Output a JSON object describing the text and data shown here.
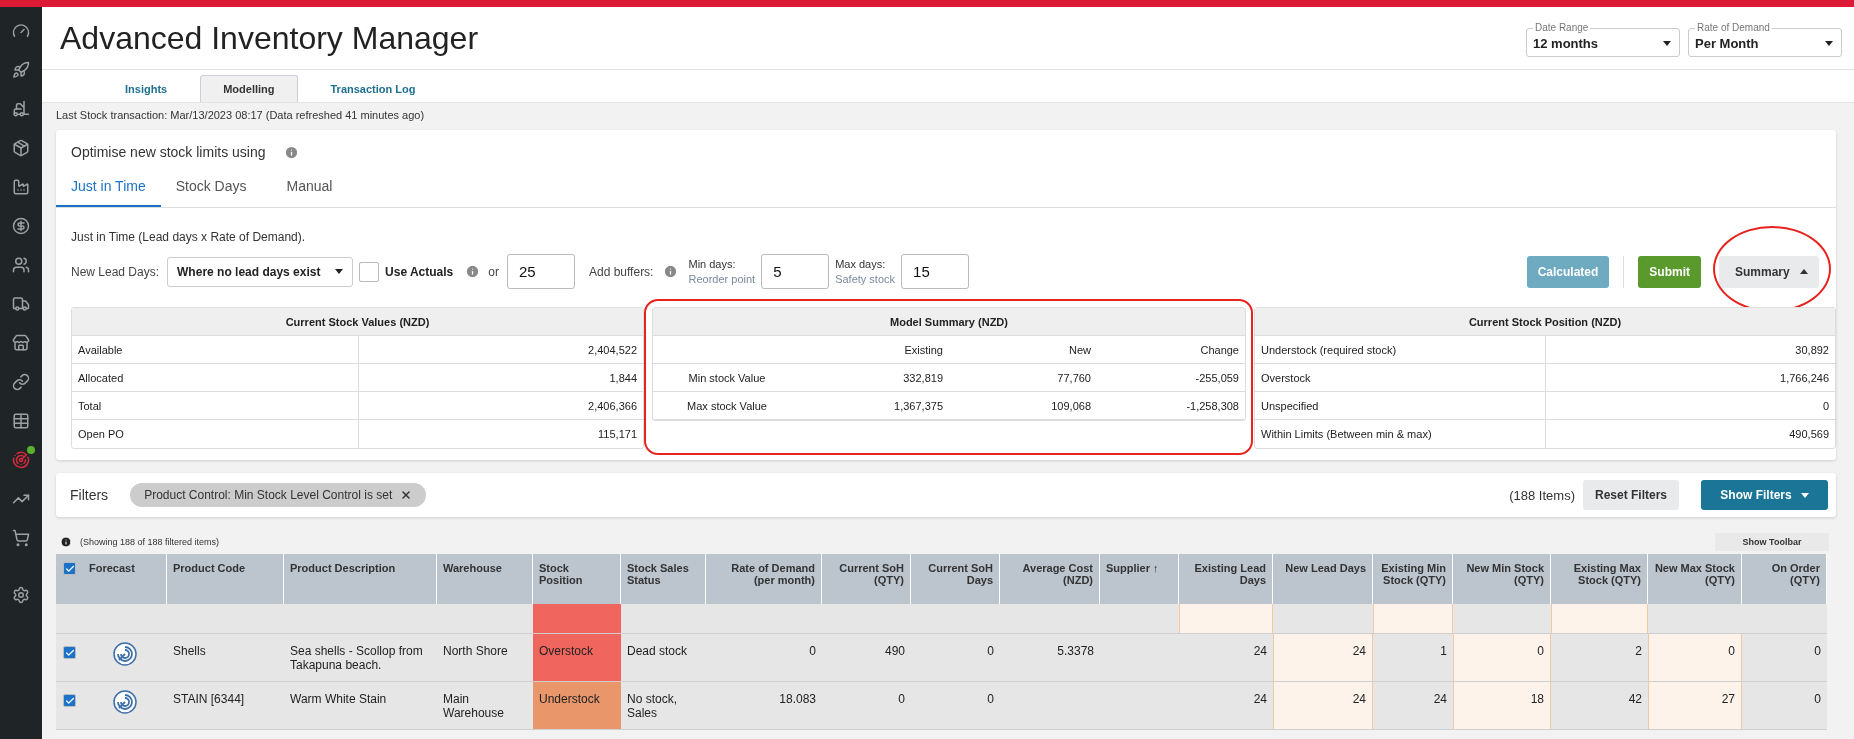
{
  "sidebar": {
    "items": [
      {
        "selected": false
      },
      {
        "selected": false
      },
      {
        "selected": false
      },
      {
        "selected": false
      },
      {
        "selected": false
      },
      {
        "selected": false
      },
      {
        "selected": false
      },
      {
        "selected": false
      },
      {
        "selected": false
      },
      {
        "selected": false
      },
      {
        "selected": false
      },
      {
        "selected": true
      },
      {
        "selected": false
      },
      {
        "selected": false
      },
      {
        "selected": false
      }
    ]
  },
  "header": {
    "title": "Advanced Inventory Manager",
    "dropdowns": [
      {
        "label": "Date Range",
        "value": "12 months"
      },
      {
        "label": "Rate of Demand",
        "value": "Per Month"
      }
    ]
  },
  "tabs": [
    {
      "label": "Insights",
      "selected": false
    },
    {
      "label": "Modelling",
      "selected": true
    },
    {
      "label": "Transaction Log",
      "selected": false
    }
  ],
  "status_line": "Last Stock transaction: Mar/13/2023 08:17 (Data refreshed 41 minutes ago)",
  "optimise": {
    "title": "Optimise new stock limits using",
    "method_tabs": [
      {
        "label": "Just in Time",
        "selected": true
      },
      {
        "label": "Stock Days",
        "selected": false
      },
      {
        "label": "Manual",
        "selected": false
      }
    ],
    "description": "Just in Time (Lead days x Rate of Demand).",
    "lead_days_label": "New Lead Days:",
    "lead_days_select": "Where no lead days exist",
    "use_actuals": {
      "label": "Use Actuals",
      "checked": false
    },
    "or_label": "or",
    "lead_days_value": "25",
    "buffers_label": "Add buffers:",
    "min_days": {
      "label": "Min days:",
      "hint": "Reorder point",
      "value": "5"
    },
    "max_days": {
      "label": "Max days:",
      "hint": "Safety stock",
      "value": "15"
    },
    "buttons": [
      {
        "label": "Calculated",
        "kind": "calculated"
      },
      {
        "label": "Submit",
        "kind": "submit"
      },
      {
        "label": "Summary",
        "kind": "toggle",
        "expanded": true,
        "highlighted": true
      }
    ]
  },
  "stock_values": {
    "title": "Current Stock Values (NZD)",
    "rows": [
      {
        "label": "Available",
        "value": "2,404,522"
      },
      {
        "label": "Allocated",
        "value": "1,844"
      },
      {
        "label": "Total",
        "value": "2,406,366"
      },
      {
        "label": "Open PO",
        "value": "115,171"
      }
    ]
  },
  "model_summary": {
    "title": "Model Summary (NZD)",
    "highlighted": true,
    "columns": [
      "Existing",
      "New",
      "Change"
    ],
    "rows": [
      {
        "label": "Min stock Value",
        "values": [
          "332,819",
          "77,760",
          "-255,059"
        ]
      },
      {
        "label": "Max stock Value",
        "values": [
          "1,367,375",
          "109,068",
          "-1,258,308"
        ]
      }
    ]
  },
  "stock_position": {
    "title": "Current Stock Position (NZD)",
    "rows": [
      {
        "label": "Understock (required stock)",
        "value": "30,892"
      },
      {
        "label": "Overstock",
        "value": "1,766,246"
      },
      {
        "label": "Unspecified",
        "value": "0"
      },
      {
        "label": "Within Limits (Between min & max)",
        "value": "490,569"
      }
    ]
  },
  "filters": {
    "label": "Filters",
    "chips": [
      {
        "label": "Product Control: Min Stock Level Control is set"
      }
    ],
    "count": "(188 Items)",
    "reset": "Reset Filters",
    "show": "Show Filters"
  },
  "table": {
    "info": "(Showing 188 of 188 filtered items)",
    "toolbar_button": "Show Toolbar",
    "all_checked": true,
    "columns": [
      "Forecast",
      "Product Code",
      "Product Description",
      "Warehouse",
      "Stock Position",
      "Stock Sales Status",
      "Rate of Demand (per month)",
      "Current SoH (QTY)",
      "Current SoH Days",
      "Average Cost (NZD)",
      "Supplier ↑",
      "Existing Lead Days",
      "New Lead Days",
      "Existing Min Stock (QTY)",
      "New Min Stock (QTY)",
      "Existing Max Stock (QTY)",
      "New Max Stock (QTY)",
      "On Order (QTY)"
    ],
    "rows": [
      {
        "checked": true,
        "color": "#f0665e",
        "cells": [
          null,
          "Shells",
          "Sea shells - Scollop from Takapuna beach.",
          "North Shore",
          "Overstock",
          "Dead stock",
          "0",
          "490",
          "0",
          "5.3378",
          null,
          "24",
          "24",
          "1",
          "0",
          "2",
          "0",
          "0"
        ]
      },
      {
        "checked": true,
        "color": "#e9966a",
        "cells": [
          null,
          "STAIN [6344]",
          "Warm White Stain",
          "Main Warehouse",
          "Understock",
          "No stock, Sales",
          "18.083",
          "0",
          "0",
          null,
          null,
          "24",
          "24",
          "24",
          "18",
          "42",
          "27",
          "0"
        ]
      }
    ]
  }
}
